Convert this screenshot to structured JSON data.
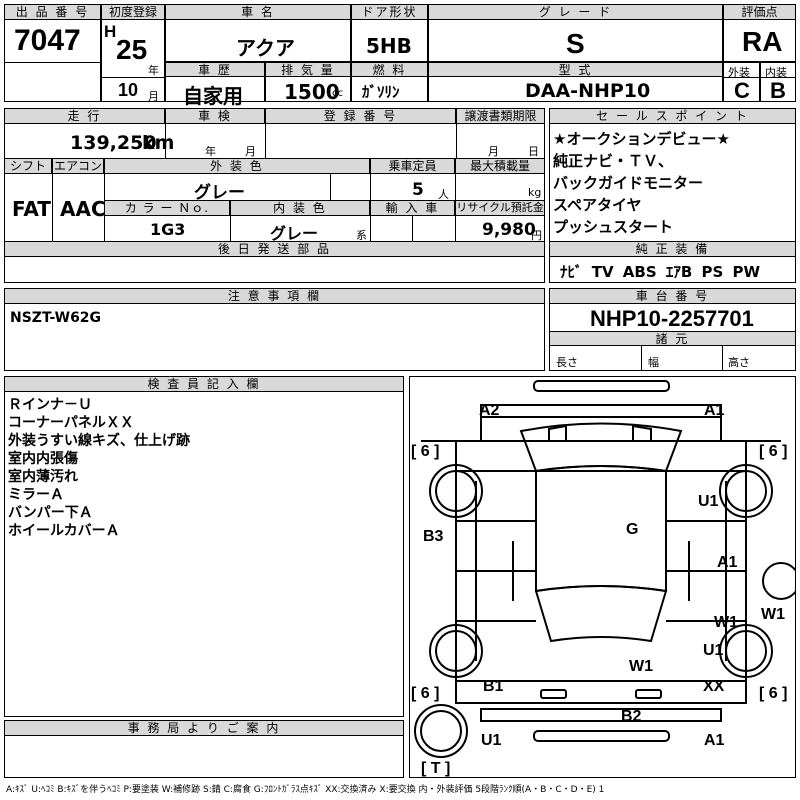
{
  "header": {
    "lot_label": "出 品 番 号",
    "lot_number": "7047",
    "first_reg_label": "初度登録",
    "era": "H",
    "year": "25",
    "year_unit": "年",
    "month": "10",
    "month_unit": "月",
    "car_name_label": "車 名",
    "car_name": "アクア",
    "door_label": "ドア形状",
    "door": "5HB",
    "grade_label": "グ レ ー ド",
    "grade": "S",
    "score_label": "評価点",
    "score": "RA",
    "history_label": "車 歴",
    "history": "自家用",
    "displacement_label": "排 気 量",
    "displacement": "1500",
    "displacement_unit": "cc",
    "fuel_label": "燃 料",
    "fuel": "ｶﾞｿﾘﾝ",
    "model_label": "型 式",
    "model": "DAA-NHP10",
    "ext_label": "外装",
    "ext_grade": "C",
    "int_label": "内装",
    "int_grade": "B"
  },
  "row2": {
    "mileage_label": "走 行",
    "mileage": "139,250",
    "mileage_unit": "km",
    "inspection_label": "車 検",
    "inspection_year": "年",
    "inspection_month": "月",
    "reg_no_label": "登 録 番 号",
    "transfer_label": "譲渡書類期限",
    "transfer_month": "月",
    "transfer_day": "日",
    "shift_label": "シフト",
    "shift": "FAT",
    "ac_label": "エアコン",
    "ac": "AAC",
    "ext_color_label": "外 装 色",
    "ext_color": "グレー",
    "capacity_label": "乗車定員",
    "capacity": "5",
    "capacity_unit": "人",
    "load_label": "最大積載量",
    "load_unit": "kg",
    "color_no_label": "カ ラ ー Ｎｏ.",
    "color_no": "1G3",
    "int_color_label": "内 装 色",
    "int_color": "グレー",
    "int_color_unit": "系",
    "import_label": "輸 入 車",
    "recycle_label": "リサイクル預託金",
    "recycle": "9,980",
    "recycle_unit": "円",
    "later_parts_label": "後 日 発 送 部 品"
  },
  "sales_point": {
    "label": "セ ー ル ス ポ イ ン ト",
    "lines": [
      "★オークションデビュー★",
      "純正ナビ・ＴＶ、",
      "バックガイドモニター",
      "スペアタイヤ",
      "プッシュスタート"
    ],
    "equip_label": "純 正 装 備",
    "equip": "ﾅﾋﾞ TV ABS ｴｱB PS PW"
  },
  "notes": {
    "label": "注 意 事 項 欄",
    "text": "NSZT-W62G"
  },
  "chassis": {
    "label": "車 台 番 号",
    "number": "NHP10-2257701",
    "spec_label": "諸 元",
    "length": "長さ",
    "width": "幅",
    "height": "高さ"
  },
  "inspector": {
    "label": "検 査 員 記 入 欄",
    "lines": [
      "Ｒインナ－Ｕ",
      "コーナーパネルＸＸ",
      "外装うすい線キズ、仕上げ跡",
      "室内内張傷",
      "室内薄汚れ",
      "ミラーＡ",
      "バンパー下Ａ",
      "ホイールカバーＡ"
    ]
  },
  "office": {
    "label": "事 務 局 よ り ご 案 内"
  },
  "diagram": {
    "marks": [
      "A2",
      "A1",
      "[ 6 ]",
      "[ 6 ]",
      "U1",
      "B3",
      "G",
      "A1",
      "W1",
      "W1",
      "U1",
      "W1",
      "B1",
      "XX",
      "[ 6 ]",
      "[ 6 ]",
      "B2",
      "U1",
      "A1",
      "[ T ]"
    ]
  },
  "legend": "A:ｷｽﾞ U:ﾍｺﾐ B:ｷｽﾞを伴うﾍｺﾐ P:要塗装 W:補修跡 S:錆 C:腐食 G:ﾌﾛﾝﾄｶﾞﾗｽ点ｷｽﾞ XX:交換済み X:要交換 内・外装評価 5段階ﾗﾝｸ順(A・B・C・D・E) 1"
}
